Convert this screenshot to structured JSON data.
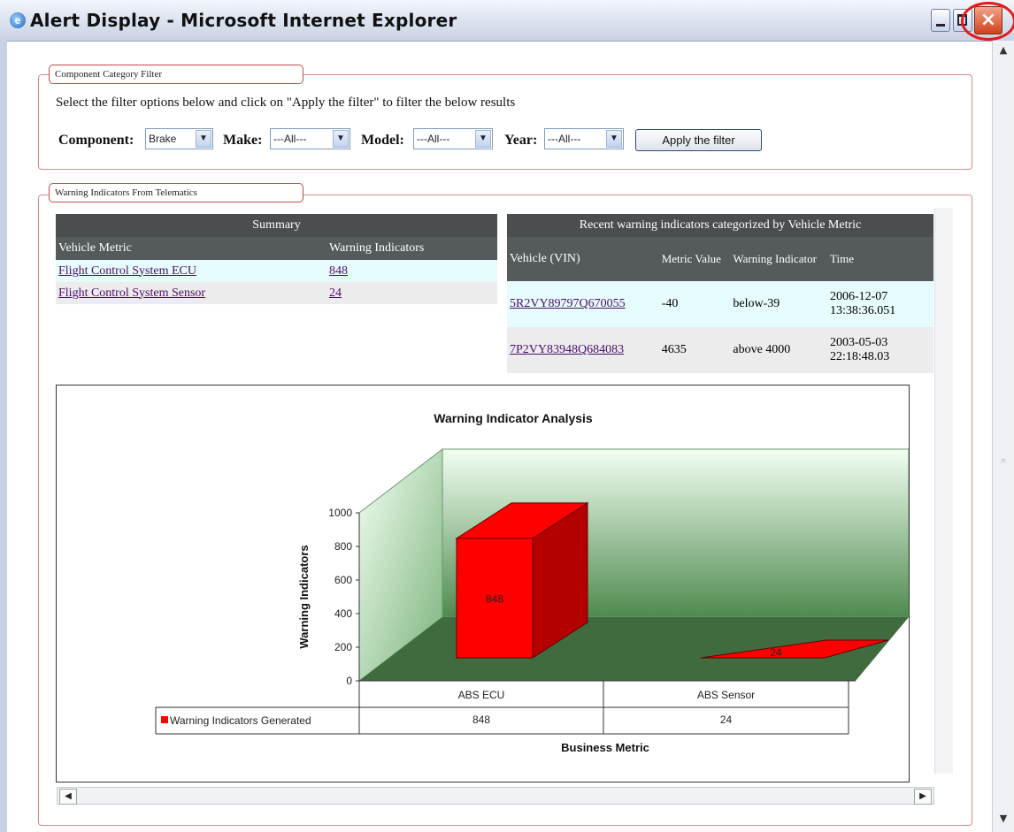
{
  "window": {
    "title": "Alert Display - Microsoft Internet Explorer"
  },
  "filter": {
    "legend": "Component Category Filter",
    "instruction": "Select the filter options below and click on \"Apply the filter\" to filter the below results",
    "component_label": "Component:",
    "component_value": "Brake",
    "make_label": "Make:",
    "make_value": "---All---",
    "model_label": "Model:",
    "model_value": "---All---",
    "year_label": "Year:",
    "year_value": "---All---",
    "apply_label": "Apply the filter"
  },
  "telematics": {
    "legend": "Warning Indicators From Telematics",
    "summary": {
      "title": "Summary",
      "columns": [
        "Vehicle Metric",
        "Warning Indicators"
      ],
      "rows": [
        {
          "metric": "Flight Control System ECU",
          "count": "848"
        },
        {
          "metric": "Flight Control System Sensor",
          "count": "24"
        }
      ]
    },
    "recent": {
      "title": "Recent warning indicators categorized by Vehicle Metric",
      "columns": [
        "Vehicle (VIN)",
        "Metric Value",
        "Warning Indicator",
        "Time"
      ],
      "rows": [
        {
          "vin": "5R2VY89797Q670055",
          "value": "-40",
          "indicator": "below-39",
          "time": "2006-12-07 13:38:36.051"
        },
        {
          "vin": "7P2VY83948Q684083",
          "value": "4635",
          "indicator": "above 4000",
          "time": "2003-05-03 22:18:48.03"
        }
      ]
    }
  },
  "chart_data": {
    "type": "bar",
    "title": "Warning Indicator Analysis",
    "xlabel": "Business Metric",
    "ylabel": "Warning Indicators",
    "categories": [
      "ABS ECU",
      "ABS Sensor"
    ],
    "series": [
      {
        "name": "Warning Indicators Generated",
        "values": [
          848,
          24
        ]
      }
    ],
    "ylim": [
      0,
      1000
    ],
    "yticks": [
      0,
      200,
      400,
      600,
      800,
      1000
    ],
    "colors": {
      "bar": "#ff0000",
      "bar_side": "#b30000",
      "wall": "#d6f5d6",
      "floor": "#3f6b3f"
    }
  }
}
